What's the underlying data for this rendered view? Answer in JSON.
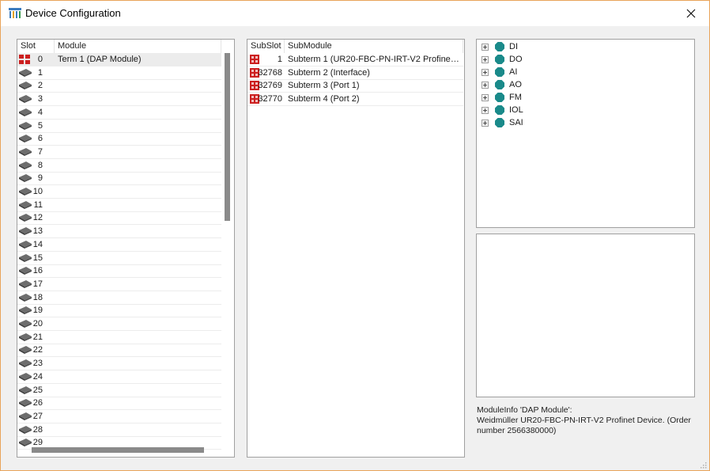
{
  "window": {
    "title": "Device Configuration",
    "accent_border": "#e8a45a"
  },
  "slots_table": {
    "headers": {
      "slot": "Slot",
      "module": "Module"
    },
    "rows": [
      {
        "slot": "0",
        "module": "Term 1 (DAP Module)",
        "icon": "dap-module-icon",
        "selected": true
      },
      {
        "slot": "1",
        "module": "",
        "icon": "empty-slot-icon"
      },
      {
        "slot": "2",
        "module": "",
        "icon": "empty-slot-icon"
      },
      {
        "slot": "3",
        "module": "",
        "icon": "empty-slot-icon"
      },
      {
        "slot": "4",
        "module": "",
        "icon": "empty-slot-icon"
      },
      {
        "slot": "5",
        "module": "",
        "icon": "empty-slot-icon"
      },
      {
        "slot": "6",
        "module": "",
        "icon": "empty-slot-icon"
      },
      {
        "slot": "7",
        "module": "",
        "icon": "empty-slot-icon"
      },
      {
        "slot": "8",
        "module": "",
        "icon": "empty-slot-icon"
      },
      {
        "slot": "9",
        "module": "",
        "icon": "empty-slot-icon"
      },
      {
        "slot": "10",
        "module": "",
        "icon": "empty-slot-icon"
      },
      {
        "slot": "11",
        "module": "",
        "icon": "empty-slot-icon"
      },
      {
        "slot": "12",
        "module": "",
        "icon": "empty-slot-icon"
      },
      {
        "slot": "13",
        "module": "",
        "icon": "empty-slot-icon"
      },
      {
        "slot": "14",
        "module": "",
        "icon": "empty-slot-icon"
      },
      {
        "slot": "15",
        "module": "",
        "icon": "empty-slot-icon"
      },
      {
        "slot": "16",
        "module": "",
        "icon": "empty-slot-icon"
      },
      {
        "slot": "17",
        "module": "",
        "icon": "empty-slot-icon"
      },
      {
        "slot": "18",
        "module": "",
        "icon": "empty-slot-icon"
      },
      {
        "slot": "19",
        "module": "",
        "icon": "empty-slot-icon"
      },
      {
        "slot": "20",
        "module": "",
        "icon": "empty-slot-icon"
      },
      {
        "slot": "21",
        "module": "",
        "icon": "empty-slot-icon"
      },
      {
        "slot": "22",
        "module": "",
        "icon": "empty-slot-icon"
      },
      {
        "slot": "23",
        "module": "",
        "icon": "empty-slot-icon"
      },
      {
        "slot": "24",
        "module": "",
        "icon": "empty-slot-icon"
      },
      {
        "slot": "25",
        "module": "",
        "icon": "empty-slot-icon"
      },
      {
        "slot": "26",
        "module": "",
        "icon": "empty-slot-icon"
      },
      {
        "slot": "27",
        "module": "",
        "icon": "empty-slot-icon"
      },
      {
        "slot": "28",
        "module": "",
        "icon": "empty-slot-icon"
      },
      {
        "slot": "29",
        "module": "",
        "icon": "empty-slot-icon"
      }
    ]
  },
  "subslots_table": {
    "headers": {
      "subslot": "SubSlot",
      "submodule": "SubModule"
    },
    "rows": [
      {
        "subslot": "1",
        "submodule": "Subterm 1 (UR20-FBC-PN-IRT-V2 Profinet ...",
        "icon": "submodule-icon"
      },
      {
        "subslot": "32768",
        "submodule": "Subterm 2 (Interface)",
        "icon": "submodule-icon"
      },
      {
        "subslot": "32769",
        "submodule": "Subterm 3 (Port 1)",
        "icon": "submodule-icon"
      },
      {
        "subslot": "32770",
        "submodule": "Subterm 4 (Port 2)",
        "icon": "submodule-icon"
      }
    ]
  },
  "catalog_tree": {
    "items": [
      {
        "label": "DI"
      },
      {
        "label": "DO"
      },
      {
        "label": "AI"
      },
      {
        "label": "AO"
      },
      {
        "label": "FM"
      },
      {
        "label": "IOL"
      },
      {
        "label": "SAI"
      }
    ],
    "node_color": "#1a8a8a"
  },
  "module_info": {
    "line1": "ModuleInfo 'DAP Module':",
    "line2": "Weidmüller UR20-FBC-PN-IRT-V2 Profinet Device. (Order number 2566380000)"
  },
  "colors": {
    "module_red": "#cc1f1f",
    "scroll_thumb": "#8a8a8a"
  }
}
